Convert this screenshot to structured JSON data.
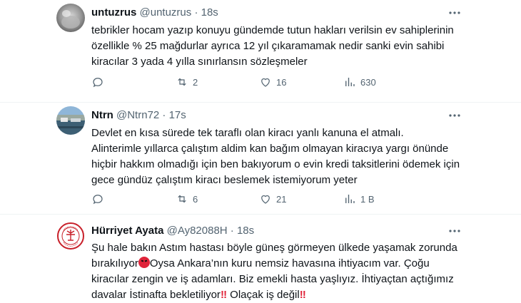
{
  "tweets": [
    {
      "name": "untuzrus",
      "handle": "@untuzrus",
      "separator": "·",
      "time": "18s",
      "avatar_icon": "gray-blurred-photo-avatar",
      "text": "tebrikler hocam yazıp konuyu gündemde tutun hakları verilsin ev sahiplerinin özellikle % 25 mağdurlar ayrıca 12 yıl çıkaramamak nedir sanki evin sahibi kiracılar 3 yada 4 yılla sınırlansın sözleşmeler",
      "replies": "",
      "reposts": "2",
      "likes": "16",
      "views": "630"
    },
    {
      "name": "Ntrn",
      "handle": "@Ntrn72",
      "separator": "·",
      "time": "17s",
      "avatar_icon": "harbor-landscape-avatar",
      "text": "Devlet en kısa sürede tek taraflı olan kiracı yanlı kanuna el atmalı.\nAlinterimle yıllarca çalıştım aldim kan bağım olmayan kiracıya yargı önünde hiçbir hakkım olmadığı için ben bakıyorum o evin kredi taksitlerini ödemek için gece gündüz çalıştım kiracı beslemek istemiyorum yeter",
      "replies": "",
      "reposts": "6",
      "likes": "21",
      "views": "1 B"
    },
    {
      "name": "Hürriyet Ayata",
      "handle": "@Ay82088H",
      "separator": "·",
      "time": "18s",
      "avatar_icon": "red-circular-seal-avatar",
      "text_parts": [
        "Şu hale bakın Astım hastası böyle güneş görmeyen ülkede yaşamak zorunda bırakılıyor",
        "Oysa Ankara’nın kuru nemsiz havasına ihtiyacım var. Çoğu kiracılar zengin ve iş adamları. Biz emekli hasta yaşlıyız. İhtiyaçtan açtığımız davalar İstinafta bekletiliyor",
        "‼",
        " Olaçak iş değil",
        "‼"
      ]
    }
  ],
  "colors": {
    "text": "#0f1419",
    "secondary": "#536471",
    "divider": "#eff3f4",
    "accent_red": "#e0243a"
  }
}
